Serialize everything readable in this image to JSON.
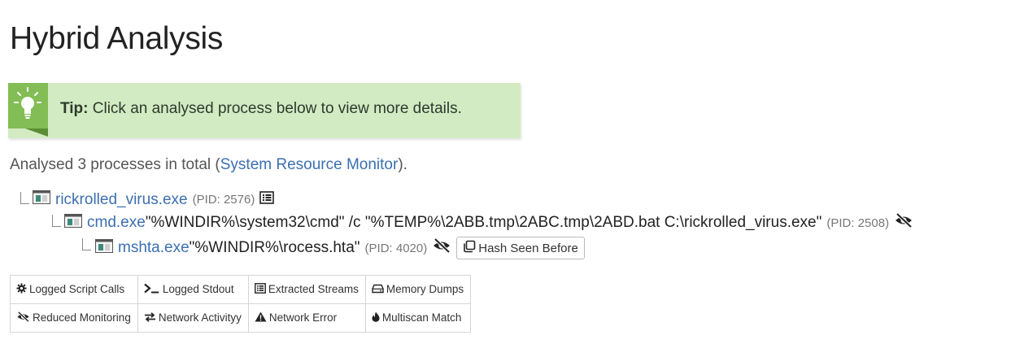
{
  "page": {
    "title": "Hybrid Analysis"
  },
  "tip": {
    "label": "Tip:",
    "text": " Click an analysed process below to view more details."
  },
  "summary": {
    "prefix": "Analysed 3 processes in total (",
    "link": "System Resource Monitor",
    "suffix": ")."
  },
  "processes": [
    {
      "name": "rickrolled_virus.exe",
      "args": "",
      "pid": "(PID: 2576)"
    },
    {
      "name": "cmd.exe",
      "args": " \"%WINDIR%\\system32\\cmd\" /c \"%TEMP%\\2ABB.tmp\\2ABC.tmp\\2ABD.bat C:\\rickrolled_virus.exe\"",
      "pid": "(PID: 2508)"
    },
    {
      "name": "mshta.exe",
      "args": " \"%WINDIR%\\rocess.hta\"",
      "pid": "(PID: 4020)",
      "badge": "Hash Seen Before"
    }
  ],
  "legend": {
    "rows": [
      [
        {
          "label": "Logged Script Calls",
          "icon": "gear-icon"
        },
        {
          "label": "Logged Stdout",
          "icon": "terminal-icon"
        },
        {
          "label": "Extracted Streams",
          "icon": "list-icon"
        },
        {
          "label": "Memory Dumps",
          "icon": "hdd-icon"
        }
      ],
      [
        {
          "label": "Reduced Monitoring",
          "icon": "eye-slash-icon"
        },
        {
          "label": "Network Activityy",
          "icon": "exchange-icon"
        },
        {
          "label": "Network Error",
          "icon": "warning-icon"
        },
        {
          "label": "Multiscan Match",
          "icon": "fire-icon"
        }
      ]
    ]
  },
  "colors": {
    "tip_bg": "#d3ebc3",
    "tip_icon": "#82bd55",
    "link": "#3b6fb0"
  }
}
